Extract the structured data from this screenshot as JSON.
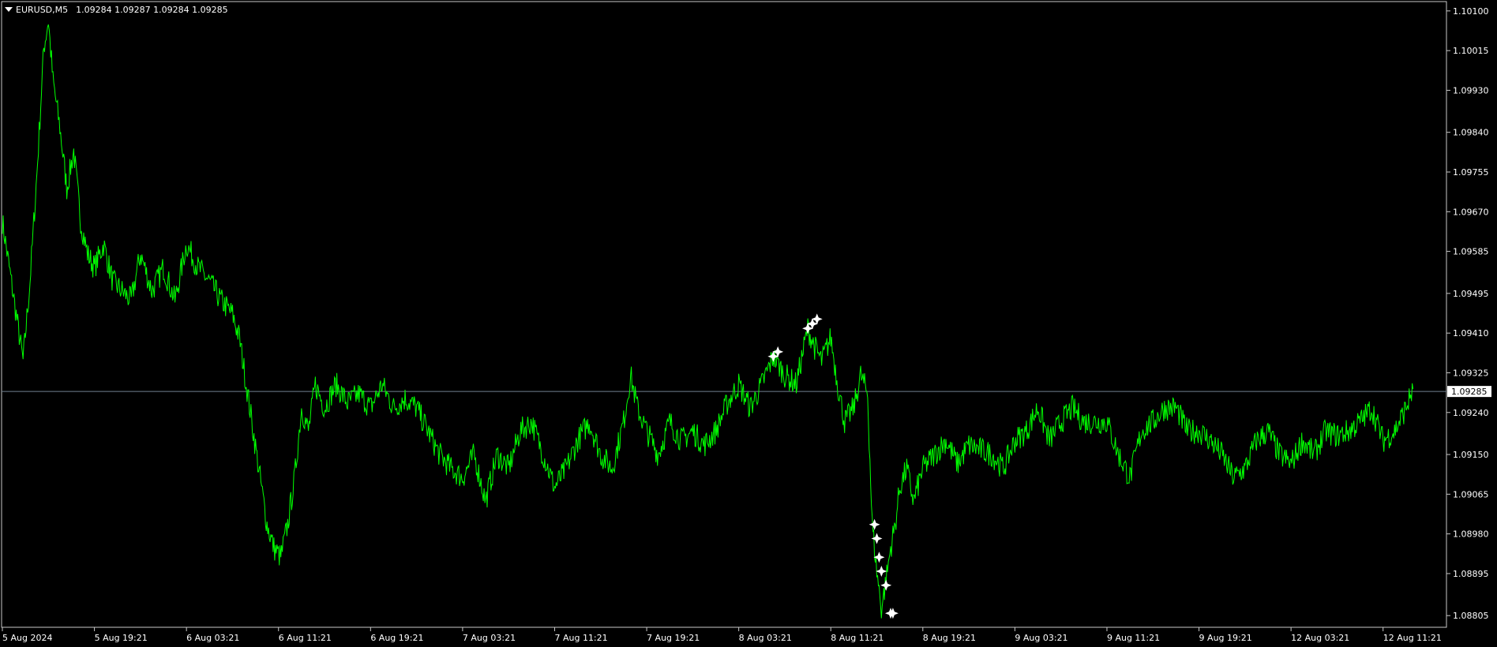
{
  "header": {
    "symbol": "EURUSD,M5",
    "quotes": "1.09284 1.09287 1.09284 1.09285",
    "menu_icon": "triangle-down-icon"
  },
  "colors": {
    "background": "#000000",
    "line": "#00FF00",
    "axis": "#C8C8C8",
    "text": "#FFFFFF",
    "markers": "#FFFFFF",
    "price_line": "#708090",
    "price_label_bg": "#FFFFFF",
    "price_label_text": "#000000"
  },
  "chart_data": {
    "type": "line",
    "title": "EURUSD,M5",
    "xlabel": "",
    "ylabel": "",
    "grid": false,
    "x_ticks": [
      "5 Aug 2024",
      "5 Aug 19:21",
      "6 Aug 03:21",
      "6 Aug 11:21",
      "6 Aug 19:21",
      "7 Aug 03:21",
      "7 Aug 11:21",
      "7 Aug 19:21",
      "8 Aug 03:21",
      "8 Aug 11:21",
      "8 Aug 19:21",
      "9 Aug 03:21",
      "9 Aug 11:21",
      "9 Aug 19:21",
      "12 Aug 03:21",
      "12 Aug 11:21"
    ],
    "y_ticks": [
      "1.10100",
      "1.10015",
      "1.09930",
      "1.09840",
      "1.09755",
      "1.09670",
      "1.09585",
      "1.09495",
      "1.09410",
      "1.09325",
      "1.09240",
      "1.09150",
      "1.09065",
      "1.08980",
      "1.08895",
      "1.08805"
    ],
    "ylim": [
      1.0878,
      1.1012
    ],
    "current_price": 1.09285,
    "current_price_label": "1.09285",
    "series": [
      {
        "values": [
          [
            0,
            1.0965
          ],
          [
            0.3,
            1.0955
          ],
          [
            0.6,
            1.0945
          ],
          [
            0.9,
            1.0935
          ],
          [
            1.2,
            1.0952
          ],
          [
            1.5,
            1.0975
          ],
          [
            1.8,
            1.1002
          ],
          [
            2.0,
            1.1008
          ],
          [
            2.2,
            1.0995
          ],
          [
            2.5,
            1.0985
          ],
          [
            2.8,
            1.0972
          ],
          [
            3.1,
            1.098
          ],
          [
            3.4,
            1.0965
          ],
          [
            3.7,
            1.0958
          ],
          [
            4.0,
            1.0955
          ],
          [
            4.4,
            1.096
          ],
          [
            4.8,
            1.0952
          ],
          [
            5.2,
            1.095
          ],
          [
            5.6,
            1.0948
          ],
          [
            6.0,
            1.0958
          ],
          [
            6.5,
            1.095
          ],
          [
            7.0,
            1.0955
          ],
          [
            7.5,
            1.0948
          ],
          [
            8.0,
            1.096
          ],
          [
            8.5,
            1.0955
          ],
          [
            9.0,
            1.0952
          ],
          [
            9.5,
            1.0948
          ],
          [
            10.0,
            1.0945
          ],
          [
            10.3,
            1.094
          ],
          [
            10.6,
            1.093
          ],
          [
            10.9,
            1.092
          ],
          [
            11.2,
            1.091
          ],
          [
            11.5,
            1.09
          ],
          [
            11.8,
            1.0895
          ],
          [
            12.1,
            1.0893
          ],
          [
            12.4,
            1.09
          ],
          [
            12.7,
            1.091
          ],
          [
            13.0,
            1.0925
          ],
          [
            13.3,
            1.092
          ],
          [
            13.6,
            1.093
          ],
          [
            14.0,
            1.0925
          ],
          [
            14.5,
            1.093
          ],
          [
            15.0,
            1.0926
          ],
          [
            15.5,
            1.0928
          ],
          [
            16.0,
            1.0925
          ],
          [
            16.5,
            1.093
          ],
          [
            17.0,
            1.0925
          ],
          [
            17.5,
            1.0927
          ],
          [
            18.0,
            1.0925
          ],
          [
            18.5,
            1.092
          ],
          [
            19.0,
            1.0915
          ],
          [
            19.5,
            1.0912
          ],
          [
            20.0,
            1.091
          ],
          [
            20.5,
            1.0915
          ],
          [
            21.0,
            1.0905
          ],
          [
            21.5,
            1.0915
          ],
          [
            22.0,
            1.0912
          ],
          [
            22.5,
            1.092
          ],
          [
            23.0,
            1.0922
          ],
          [
            23.5,
            1.0915
          ],
          [
            24.0,
            1.0908
          ],
          [
            24.5,
            1.0912
          ],
          [
            25.0,
            1.0918
          ],
          [
            25.5,
            1.0922
          ],
          [
            26.0,
            1.0915
          ],
          [
            26.5,
            1.0912
          ],
          [
            27.0,
            1.0922
          ],
          [
            27.3,
            1.0932
          ],
          [
            27.6,
            1.0925
          ],
          [
            28.0,
            1.092
          ],
          [
            28.5,
            1.0915
          ],
          [
            29.0,
            1.0922
          ],
          [
            29.5,
            1.0918
          ],
          [
            30.0,
            1.092
          ],
          [
            30.5,
            1.0917
          ],
          [
            31.0,
            1.092
          ],
          [
            31.5,
            1.0926
          ],
          [
            32.0,
            1.093
          ],
          [
            32.5,
            1.0925
          ],
          [
            33.0,
            1.093
          ],
          [
            33.5,
            1.0936
          ],
          [
            34.0,
            1.0932
          ],
          [
            34.5,
            1.093
          ],
          [
            35.0,
            1.0942
          ],
          [
            35.3,
            1.0938
          ],
          [
            35.6,
            1.0935
          ],
          [
            36.0,
            1.094
          ],
          [
            36.3,
            1.093
          ],
          [
            36.6,
            1.0922
          ],
          [
            37.0,
            1.0925
          ],
          [
            37.3,
            1.0932
          ],
          [
            37.6,
            1.0928
          ],
          [
            37.8,
            1.09
          ],
          [
            38.0,
            1.089
          ],
          [
            38.2,
            1.0882
          ],
          [
            38.4,
            1.0888
          ],
          [
            38.6,
            1.0895
          ],
          [
            38.8,
            1.09
          ],
          [
            39.0,
            1.0908
          ],
          [
            39.3,
            1.0912
          ],
          [
            39.6,
            1.0905
          ],
          [
            40.0,
            1.0912
          ],
          [
            40.5,
            1.0915
          ],
          [
            41.0,
            1.0918
          ],
          [
            41.5,
            1.0913
          ],
          [
            42.0,
            1.0917
          ],
          [
            42.5,
            1.0916
          ],
          [
            43.0,
            1.0915
          ],
          [
            43.5,
            1.0912
          ],
          [
            44.0,
            1.0918
          ],
          [
            44.5,
            1.092
          ],
          [
            45.0,
            1.0925
          ],
          [
            45.5,
            1.0918
          ],
          [
            46.0,
            1.0922
          ],
          [
            46.5,
            1.0925
          ],
          [
            47.0,
            1.0922
          ],
          [
            47.5,
            1.0922
          ],
          [
            48.0,
            1.0922
          ],
          [
            48.5,
            1.0915
          ],
          [
            49.0,
            1.091
          ],
          [
            49.5,
            1.092
          ],
          [
            50.0,
            1.0922
          ],
          [
            50.5,
            1.0925
          ],
          [
            51.0,
            1.0925
          ],
          [
            51.5,
            1.092
          ],
          [
            52.0,
            1.092
          ],
          [
            52.5,
            1.0918
          ],
          [
            53.0,
            1.0915
          ],
          [
            53.5,
            1.091
          ],
          [
            54.0,
            1.0912
          ],
          [
            54.5,
            1.0918
          ],
          [
            55.0,
            1.092
          ],
          [
            55.5,
            1.0915
          ],
          [
            56.0,
            1.0913
          ],
          [
            56.5,
            1.0918
          ],
          [
            57.0,
            1.0915
          ],
          [
            57.5,
            1.092
          ],
          [
            58.0,
            1.0919
          ],
          [
            58.5,
            1.092
          ],
          [
            59.0,
            1.0922
          ],
          [
            59.5,
            1.0925
          ],
          [
            60.0,
            1.0918
          ],
          [
            60.5,
            1.092
          ],
          [
            61.0,
            1.0925
          ],
          [
            61.3,
            1.0929
          ]
        ]
      }
    ],
    "markers": [
      [
        33.5,
        1.0936
      ],
      [
        33.7,
        1.0937
      ],
      [
        35.0,
        1.0942
      ],
      [
        35.2,
        1.0943
      ],
      [
        35.4,
        1.0944
      ],
      [
        37.9,
        1.09
      ],
      [
        38.0,
        1.0897
      ],
      [
        38.1,
        1.0893
      ],
      [
        38.2,
        1.089
      ],
      [
        38.4,
        1.0887
      ],
      [
        38.6,
        1.0881
      ],
      [
        38.7,
        1.0881
      ]
    ]
  }
}
